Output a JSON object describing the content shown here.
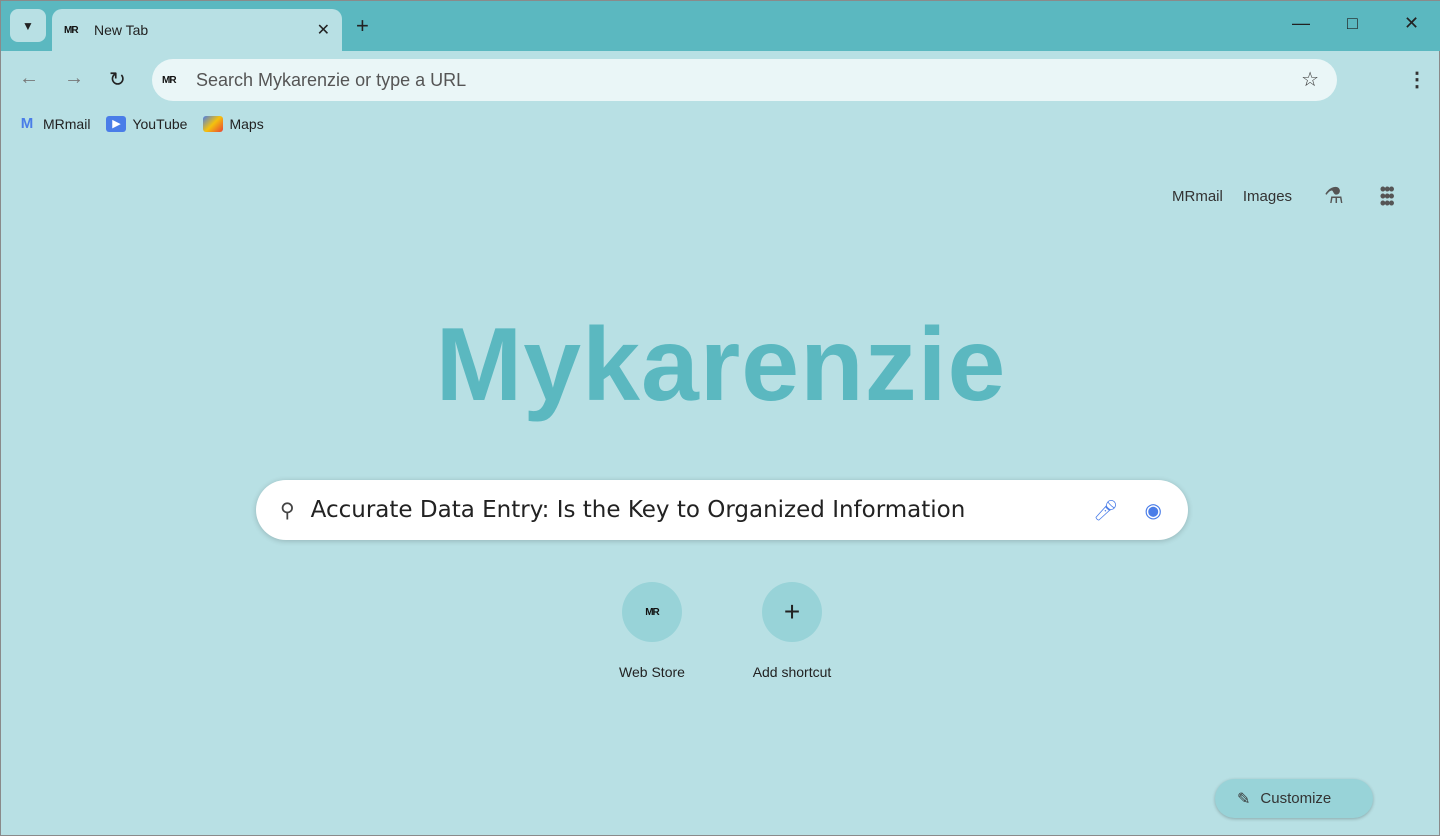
{
  "tab": {
    "title": "New Tab"
  },
  "omnibox": {
    "placeholder": "Search Mykarenzie or type a URL"
  },
  "bookmarks": [
    {
      "label": "MRmail",
      "icon": "mail-icon"
    },
    {
      "label": "YouTube",
      "icon": "youtube-icon"
    },
    {
      "label": "Maps",
      "icon": "maps-icon"
    }
  ],
  "toplinks": {
    "mail": "MRmail",
    "images": "Images"
  },
  "logo": "Mykarenzie",
  "search": {
    "query": "Accurate Data Entry: Is the Key to Organized Information"
  },
  "shortcuts": [
    {
      "label": "Web Store"
    },
    {
      "label": "Add shortcut"
    }
  ],
  "customize": "Customize",
  "colors": {
    "frame": "#5bb8c0",
    "background": "#b8e0e4",
    "accent": "#5bb8c0"
  }
}
